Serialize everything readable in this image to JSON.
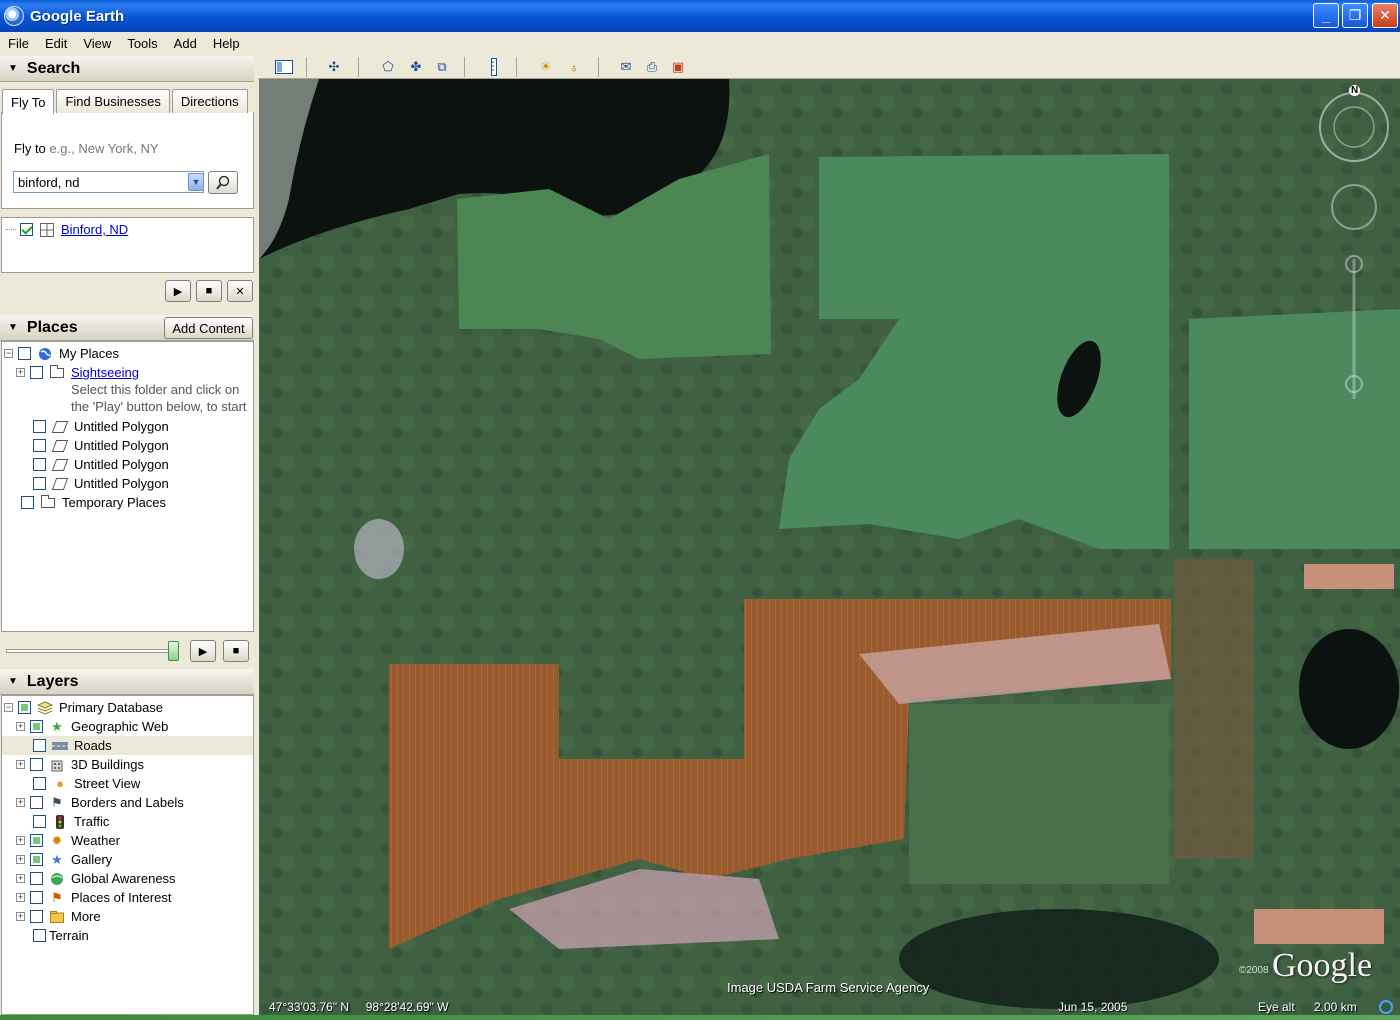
{
  "window": {
    "title": "Google Earth",
    "min_label": "_",
    "max_label": "❐",
    "close_label": "✕"
  },
  "menu": [
    "File",
    "Edit",
    "View",
    "Tools",
    "Add",
    "Help"
  ],
  "search": {
    "header": "Search",
    "tabs": [
      "Fly To",
      "Find Businesses",
      "Directions"
    ],
    "fly_to_label": "Fly to",
    "fly_to_hint": "e.g., New York, NY",
    "query": "binford, nd",
    "result": "Binford, ND"
  },
  "places": {
    "header": "Places",
    "add_content": "Add Content",
    "items": {
      "my_places": "My Places",
      "sightseeing": "Sightseeing",
      "hint_line1": "Select this folder and click on",
      "hint_line2": "the 'Play' button below, to start",
      "poly1": "Untitled Polygon",
      "poly2": "Untitled Polygon",
      "poly3": "Untitled Polygon",
      "poly4": "Untitled Polygon",
      "temp": "Temporary Places"
    }
  },
  "layers": {
    "header": "Layers",
    "items": {
      "primary": "Primary Database",
      "geo_web": "Geographic Web",
      "roads": "Roads",
      "buildings": "3D Buildings",
      "street_view": "Street View",
      "borders": "Borders and Labels",
      "traffic": "Traffic",
      "weather": "Weather",
      "gallery": "Gallery",
      "global": "Global Awareness",
      "poi": "Places of Interest",
      "more": "More",
      "terrain": "Terrain"
    }
  },
  "map": {
    "attribution": "Image USDA Farm Service Agency",
    "coordinates": "47°33'03.76\" N     98°28'42.69\" W",
    "date": "Jun 15, 2005",
    "eye_alt_label": "Eye alt",
    "eye_alt_value": "2.00 km",
    "logo": "Google",
    "copyright": "©2008",
    "north": "N"
  },
  "icons": {
    "play": "▶",
    "stop": "■",
    "close": "✕",
    "search": "🔍"
  }
}
